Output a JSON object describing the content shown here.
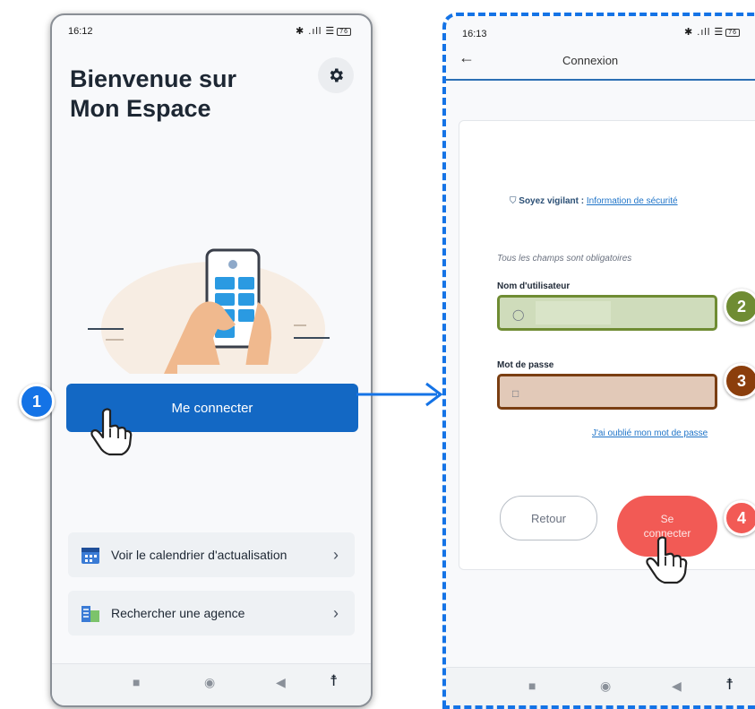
{
  "screen1": {
    "status_time": "16:12",
    "battery": "76",
    "title_line1": "Bienvenue sur",
    "title_line2": "Mon Espace",
    "login_button": "Me connecter",
    "menu": [
      {
        "label": "Voir le calendrier d'actualisation",
        "icon": "calendar-icon"
      },
      {
        "label": "Rechercher une agence",
        "icon": "building-icon"
      }
    ]
  },
  "screen2": {
    "status_time": "16:13",
    "battery": "76",
    "header_title": "Connexion",
    "vigilant_bold": "Soyez vigilant :",
    "vigilant_link": "Information de sécurité",
    "required_note": "Tous les champs sont obligatoires",
    "username_label": "Nom d'utilisateur",
    "password_label": "Mot de passe",
    "forgot_link": "J'ai oublié mon mot de passe",
    "back_button": "Retour",
    "login_button_line1": "Se",
    "login_button_line2": "connecter"
  },
  "badges": [
    "1",
    "2",
    "3",
    "4"
  ],
  "colors": {
    "primary": "#1368c4",
    "badge1": "#1473e6",
    "badge2": "#6f8c33",
    "badge3": "#8b3e0c",
    "badge4": "#f25a55",
    "dashed_frame": "#1473e6"
  }
}
